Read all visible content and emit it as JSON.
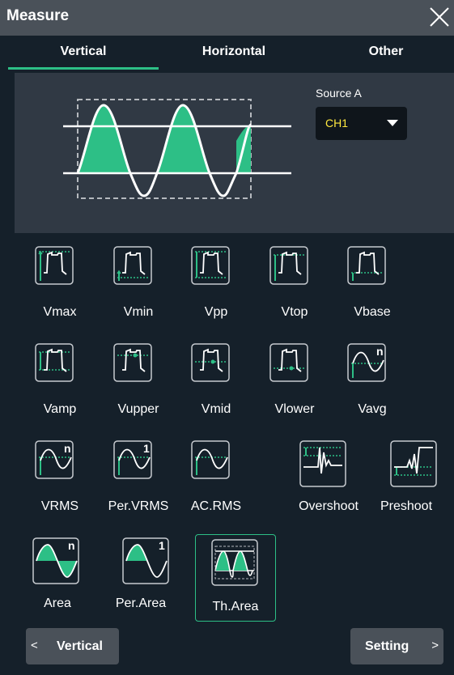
{
  "title": "Measure",
  "tabs": [
    {
      "label": "Vertical",
      "active": true
    },
    {
      "label": "Horizontal",
      "active": false
    },
    {
      "label": "Other",
      "active": false
    }
  ],
  "source": {
    "label": "Source A",
    "value": "CH1"
  },
  "measurements": [
    {
      "label": "Vmax",
      "icon": "vmax-icon"
    },
    {
      "label": "Vmin",
      "icon": "vmin-icon"
    },
    {
      "label": "Vpp",
      "icon": "vpp-icon"
    },
    {
      "label": "Vtop",
      "icon": "vtop-icon"
    },
    {
      "label": "Vbase",
      "icon": "vbase-icon"
    },
    {
      "label": "Vamp",
      "icon": "vamp-icon"
    },
    {
      "label": "Vupper",
      "icon": "vupper-icon"
    },
    {
      "label": "Vmid",
      "icon": "vmid-icon"
    },
    {
      "label": "Vlower",
      "icon": "vlower-icon"
    },
    {
      "label": "Vavg",
      "icon": "vavg-icon",
      "badge": "n"
    },
    {
      "label": "VRMS",
      "icon": "vrms-icon",
      "badge": "n"
    },
    {
      "label": "Per.VRMS",
      "icon": "per-vrms-icon",
      "badge": "1"
    },
    {
      "label": "AC.RMS",
      "icon": "ac-rms-icon"
    },
    {
      "label": "Overshoot",
      "icon": "overshoot-icon"
    },
    {
      "label": "Preshoot",
      "icon": "preshoot-icon"
    },
    {
      "label": "Area",
      "icon": "area-icon",
      "badge": "n"
    },
    {
      "label": "Per.Area",
      "icon": "per-area-icon",
      "badge": "1"
    },
    {
      "label": "Th.Area",
      "icon": "th-area-icon",
      "selected": true
    }
  ],
  "buttons": {
    "back_label": "Vertical",
    "setting_label": "Setting"
  },
  "colors": {
    "accent": "#2dbf86",
    "channel": "#ffe83f",
    "panel": "#303944",
    "background": "#15202a",
    "titlebar": "#4a5159"
  }
}
